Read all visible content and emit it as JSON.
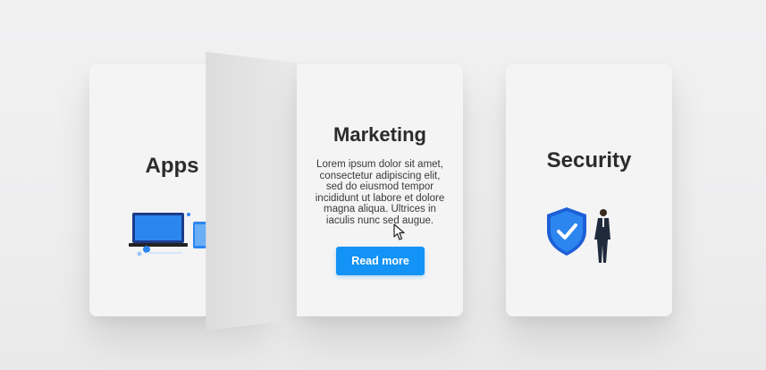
{
  "cards": {
    "apps": {
      "title": "Apps",
      "illustration": "devices-illustration"
    },
    "marketing": {
      "title": "Marketing",
      "body": "Lorem ipsum dolor sit amet, consectetur adipiscing elit, sed do eiusmod tempor incididunt ut labore et dolore magna aliqua. Ultrices in iaculis nunc sed augue.",
      "button_label": "Read more"
    },
    "security": {
      "title": "Security",
      "illustration": "shield-check-businessman-illustration"
    }
  },
  "colors": {
    "accent": "#1493f6",
    "card_bg": "#f4f4f5",
    "page_bg": "#efeff0",
    "title_text": "#2b2b2b"
  }
}
